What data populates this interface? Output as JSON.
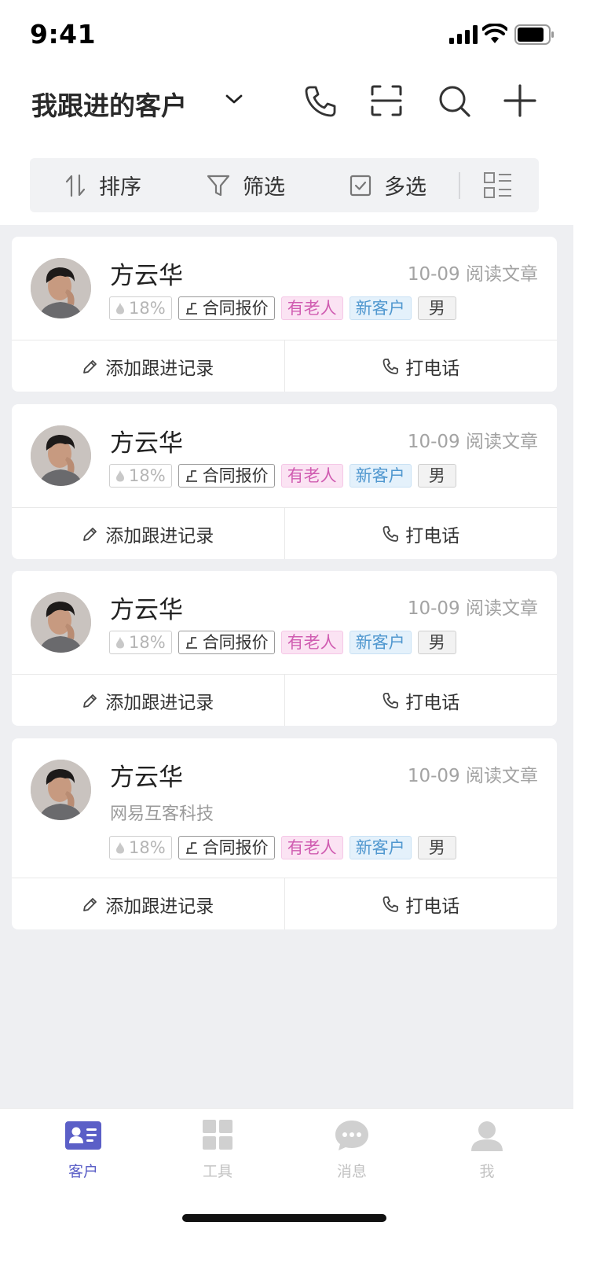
{
  "status_bar": {
    "time": "9:41"
  },
  "header": {
    "title": "我跟进的客户"
  },
  "toolbar": {
    "sort": "排序",
    "filter": "筛选",
    "multi": "多选"
  },
  "cards": [
    {
      "name": "方云华",
      "meta": "10-09 阅读文章",
      "company": "",
      "score": "18%",
      "contract": "合同报价",
      "tag_elder": "有老人",
      "tag_new": "新客户",
      "gender": "男",
      "action_follow": "添加跟进记录",
      "action_call": "打电话"
    },
    {
      "name": "方云华",
      "meta": "10-09 阅读文章",
      "company": "",
      "score": "18%",
      "contract": "合同报价",
      "tag_elder": "有老人",
      "tag_new": "新客户",
      "gender": "男",
      "action_follow": "添加跟进记录",
      "action_call": "打电话"
    },
    {
      "name": "方云华",
      "meta": "10-09 阅读文章",
      "company": "",
      "score": "18%",
      "contract": "合同报价",
      "tag_elder": "有老人",
      "tag_new": "新客户",
      "gender": "男",
      "action_follow": "添加跟进记录",
      "action_call": "打电话"
    },
    {
      "name": "方云华",
      "meta": "10-09 阅读文章",
      "company": "网易互客科技",
      "score": "18%",
      "contract": "合同报价",
      "tag_elder": "有老人",
      "tag_new": "新客户",
      "gender": "男",
      "action_follow": "添加跟进记录",
      "action_call": "打电话"
    }
  ],
  "tabbar": {
    "items": [
      {
        "label": "客户",
        "icon": "contact-card-icon",
        "active": true
      },
      {
        "label": "工具",
        "icon": "grid-icon",
        "active": false
      },
      {
        "label": "消息",
        "icon": "chat-bubble-icon",
        "active": false
      },
      {
        "label": "我",
        "icon": "person-icon",
        "active": false
      }
    ]
  },
  "colors": {
    "accent": "#5b5fc7",
    "tag_elder": "#d05cb1",
    "tag_new": "#4f97cf"
  }
}
